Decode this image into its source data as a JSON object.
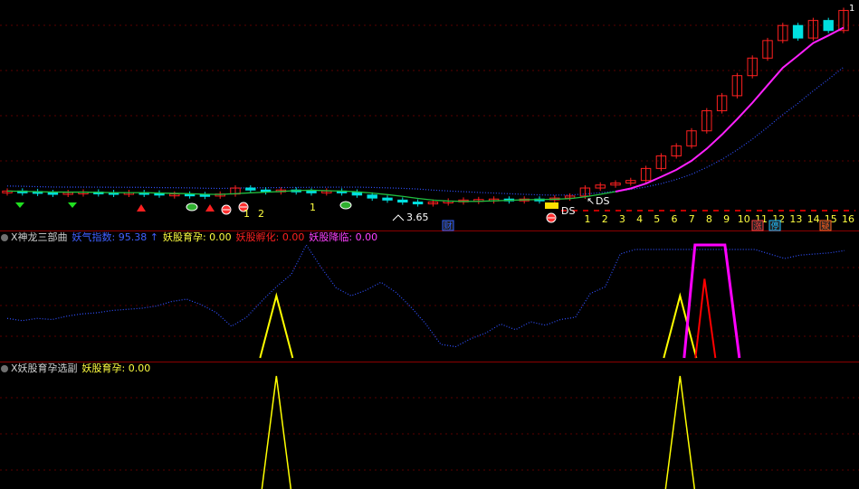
{
  "colors": {
    "background": "#000000",
    "separator": "#8b0000",
    "grid": "#5a0000",
    "up_candle": "#ff2020",
    "down_candle": "#00e0e0",
    "ma_pink": "#ff20ff",
    "blue_dotted": "#3050ff",
    "yellow": "#ffff00",
    "red": "#ff0000",
    "magenta": "#ff00ff"
  },
  "panel1": {
    "annotations": {
      "ds_label": "DS",
      "low_price": "3.65",
      "arrow_glyph": "↖",
      "early_labels": [
        "1",
        "2",
        "1"
      ],
      "corner_label": "1"
    },
    "day_counter": [
      "1",
      "2",
      "3",
      "4",
      "5",
      "6",
      "7",
      "8",
      "9",
      "10",
      "11",
      "12",
      "13",
      "14",
      "15",
      "16"
    ],
    "badges": {
      "cai": "财",
      "zhang": "涨",
      "ting": "停",
      "yi": "疑"
    }
  },
  "panel2": {
    "title": "X神龙三部曲",
    "items": [
      {
        "label": "妖气指数:",
        "value": "95.38",
        "suffix": "↑",
        "color": "#4060ff"
      },
      {
        "label": "妖股育孕:",
        "value": "0.00",
        "color": "#ffff40"
      },
      {
        "label": "妖股孵化:",
        "value": "0.00",
        "color": "#ff2020"
      },
      {
        "label": "妖股降临:",
        "value": "0.00",
        "color": "#ff40ff"
      }
    ]
  },
  "panel3": {
    "title": "X妖股育孕选副",
    "items": [
      {
        "label": "妖股育孕:",
        "value": "0.00",
        "color": "#ffff40"
      }
    ]
  },
  "chart_data": {
    "type": "line",
    "panels": [
      {
        "name": "main",
        "candles": [
          {
            "o": 3.88,
            "c": 3.9
          },
          {
            "o": 3.9,
            "c": 3.89
          },
          {
            "o": 3.89,
            "c": 3.87
          },
          {
            "o": 3.87,
            "c": 3.86
          },
          {
            "o": 3.86,
            "c": 3.87
          },
          {
            "o": 3.87,
            "c": 3.88
          },
          {
            "o": 3.88,
            "c": 3.87
          },
          {
            "o": 3.87,
            "c": 3.86
          },
          {
            "o": 3.86,
            "c": 3.87
          },
          {
            "o": 3.87,
            "c": 3.86
          },
          {
            "o": 3.86,
            "c": 3.82
          },
          {
            "o": 3.82,
            "c": 3.84
          },
          {
            "o": 3.84,
            "c": 3.83
          },
          {
            "o": 3.83,
            "c": 3.8
          },
          {
            "o": 3.8,
            "c": 3.84
          },
          {
            "o": 3.84,
            "c": 3.96
          },
          {
            "o": 3.96,
            "c": 3.92
          },
          {
            "o": 3.92,
            "c": 3.91
          },
          {
            "o": 3.91,
            "c": 3.92
          },
          {
            "o": 3.92,
            "c": 3.9
          },
          {
            "o": 3.9,
            "c": 3.89
          },
          {
            "o": 3.89,
            "c": 3.9
          },
          {
            "o": 3.9,
            "c": 3.88
          },
          {
            "o": 3.88,
            "c": 3.82
          },
          {
            "o": 3.82,
            "c": 3.76
          },
          {
            "o": 3.76,
            "c": 3.72
          },
          {
            "o": 3.72,
            "c": 3.68
          },
          {
            "o": 3.68,
            "c": 3.66
          },
          {
            "o": 3.66,
            "c": 3.68
          },
          {
            "o": 3.68,
            "c": 3.7
          },
          {
            "o": 3.7,
            "c": 3.72
          },
          {
            "o": 3.72,
            "c": 3.73
          },
          {
            "o": 3.73,
            "c": 3.74
          },
          {
            "o": 3.74,
            "c": 3.72
          },
          {
            "o": 3.72,
            "c": 3.74
          },
          {
            "o": 3.74,
            "c": 3.73
          },
          {
            "o": 3.73,
            "c": 3.76
          },
          {
            "o": 3.76,
            "c": 3.8
          },
          {
            "o": 3.8,
            "c": 3.96
          },
          {
            "o": 3.96,
            "c": 4.02
          },
          {
            "o": 4.02,
            "c": 4.06
          },
          {
            "o": 4.06,
            "c": 4.11
          },
          {
            "o": 4.11,
            "c": 4.35
          },
          {
            "o": 4.35,
            "c": 4.6
          },
          {
            "o": 4.6,
            "c": 4.8
          },
          {
            "o": 4.8,
            "c": 5.1
          },
          {
            "o": 5.1,
            "c": 5.5
          },
          {
            "o": 5.5,
            "c": 5.8
          },
          {
            "o": 5.8,
            "c": 6.2
          },
          {
            "o": 6.2,
            "c": 6.55
          },
          {
            "o": 6.55,
            "c": 6.9
          },
          {
            "o": 6.9,
            "c": 7.2
          },
          {
            "o": 7.2,
            "c": 6.95
          },
          {
            "o": 6.95,
            "c": 7.3
          },
          {
            "o": 7.3,
            "c": 7.1
          },
          {
            "o": 7.1,
            "c": 7.5
          }
        ]
      },
      {
        "name": "X神龙三部曲",
        "series": [
          {
            "name": "妖气指数",
            "values": [
              35,
              33,
              35,
              34,
              37,
              39,
              40,
              42,
              43,
              44,
              46,
              50,
              52,
              47,
              40,
              28,
              36,
              50,
              63,
              74,
              100,
              80,
              62,
              55,
              60,
              67,
              58,
              45,
              30,
              12,
              10,
              17,
              22,
              30,
              25,
              32,
              29,
              34,
              36,
              57,
              63,
              92,
              96,
              96,
              96,
              96,
              96,
              96,
              96,
              96,
              96,
              92,
              88,
              91,
              92,
              93,
              95
            ]
          },
          {
            "name": "妖股育孕",
            "spikes": [
              {
                "x": 18,
                "peak": 55
              },
              {
                "x": 45,
                "peak": 55
              }
            ]
          },
          {
            "name": "妖股孵化",
            "spikes": [
              {
                "x": 47,
                "peak": 70
              }
            ]
          },
          {
            "name": "妖股降临",
            "plateau": {
              "from": 46,
              "to": 48,
              "peak": 100
            }
          }
        ]
      },
      {
        "name": "X妖股育孕选副",
        "series": [
          {
            "name": "妖股育孕",
            "spikes": [
              {
                "x": 18,
                "peak": 100
              },
              {
                "x": 45,
                "peak": 100
              }
            ]
          }
        ]
      }
    ]
  }
}
